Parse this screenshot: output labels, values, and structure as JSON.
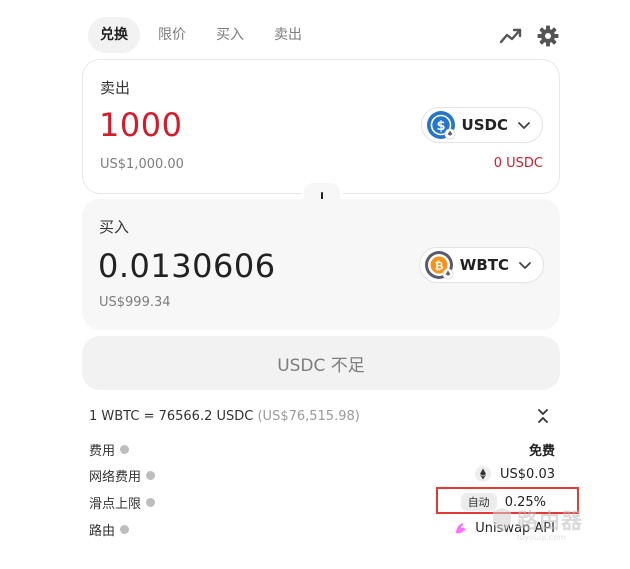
{
  "tabs": [
    "兑换",
    "限价",
    "买入",
    "卖出"
  ],
  "sell": {
    "label": "卖出",
    "amount": "1000",
    "usd_value": "US$1,000.00",
    "token": "USDC",
    "token_color": "#2775ca",
    "balance": "0 USDC"
  },
  "buy": {
    "label": "买入",
    "amount": "0.0130606",
    "usd_value": "US$999.34",
    "token": "WBTC",
    "token_color": "#f7931a"
  },
  "action_button": "USDC 不足",
  "rate": {
    "text": "1 WBTC = 76566.2 USDC",
    "usd": "(US$76,515.98)"
  },
  "details": [
    {
      "label": "费用",
      "value": "免费"
    },
    {
      "label": "网络费用",
      "value": "US$0.03",
      "icon": "ethereum-icon"
    },
    {
      "label": "滑点上限",
      "badge": "自动",
      "value": "0.25%"
    },
    {
      "label": "路由",
      "value": "Uniswap API",
      "icon": "uniswap-icon"
    }
  ],
  "watermark": {
    "text": "路由器",
    "url": "luyouqi.com"
  }
}
